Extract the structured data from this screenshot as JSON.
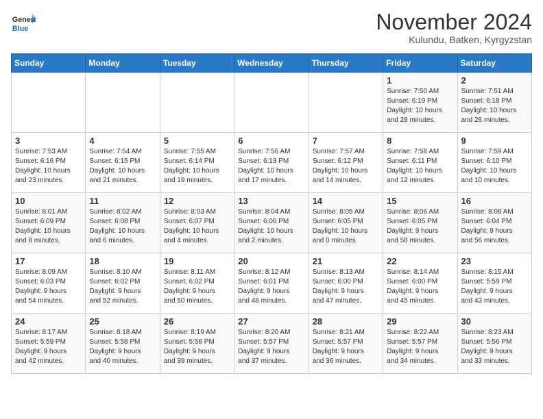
{
  "logo": {
    "line1": "General",
    "line2": "Blue"
  },
  "header": {
    "month": "November 2024",
    "location": "Kulundu, Batken, Kyrgyzstan"
  },
  "weekdays": [
    "Sunday",
    "Monday",
    "Tuesday",
    "Wednesday",
    "Thursday",
    "Friday",
    "Saturday"
  ],
  "weeks": [
    [
      {
        "day": "",
        "info": ""
      },
      {
        "day": "",
        "info": ""
      },
      {
        "day": "",
        "info": ""
      },
      {
        "day": "",
        "info": ""
      },
      {
        "day": "",
        "info": ""
      },
      {
        "day": "1",
        "info": "Sunrise: 7:50 AM\nSunset: 6:19 PM\nDaylight: 10 hours\nand 28 minutes."
      },
      {
        "day": "2",
        "info": "Sunrise: 7:51 AM\nSunset: 6:18 PM\nDaylight: 10 hours\nand 26 minutes."
      }
    ],
    [
      {
        "day": "3",
        "info": "Sunrise: 7:53 AM\nSunset: 6:16 PM\nDaylight: 10 hours\nand 23 minutes."
      },
      {
        "day": "4",
        "info": "Sunrise: 7:54 AM\nSunset: 6:15 PM\nDaylight: 10 hours\nand 21 minutes."
      },
      {
        "day": "5",
        "info": "Sunrise: 7:55 AM\nSunset: 6:14 PM\nDaylight: 10 hours\nand 19 minutes."
      },
      {
        "day": "6",
        "info": "Sunrise: 7:56 AM\nSunset: 6:13 PM\nDaylight: 10 hours\nand 17 minutes."
      },
      {
        "day": "7",
        "info": "Sunrise: 7:57 AM\nSunset: 6:12 PM\nDaylight: 10 hours\nand 14 minutes."
      },
      {
        "day": "8",
        "info": "Sunrise: 7:58 AM\nSunset: 6:11 PM\nDaylight: 10 hours\nand 12 minutes."
      },
      {
        "day": "9",
        "info": "Sunrise: 7:59 AM\nSunset: 6:10 PM\nDaylight: 10 hours\nand 10 minutes."
      }
    ],
    [
      {
        "day": "10",
        "info": "Sunrise: 8:01 AM\nSunset: 6:09 PM\nDaylight: 10 hours\nand 8 minutes."
      },
      {
        "day": "11",
        "info": "Sunrise: 8:02 AM\nSunset: 6:08 PM\nDaylight: 10 hours\nand 6 minutes."
      },
      {
        "day": "12",
        "info": "Sunrise: 8:03 AM\nSunset: 6:07 PM\nDaylight: 10 hours\nand 4 minutes."
      },
      {
        "day": "13",
        "info": "Sunrise: 8:04 AM\nSunset: 6:06 PM\nDaylight: 10 hours\nand 2 minutes."
      },
      {
        "day": "14",
        "info": "Sunrise: 8:05 AM\nSunset: 6:05 PM\nDaylight: 10 hours\nand 0 minutes."
      },
      {
        "day": "15",
        "info": "Sunrise: 8:06 AM\nSunset: 6:05 PM\nDaylight: 9 hours\nand 58 minutes."
      },
      {
        "day": "16",
        "info": "Sunrise: 8:08 AM\nSunset: 6:04 PM\nDaylight: 9 hours\nand 56 minutes."
      }
    ],
    [
      {
        "day": "17",
        "info": "Sunrise: 8:09 AM\nSunset: 6:03 PM\nDaylight: 9 hours\nand 54 minutes."
      },
      {
        "day": "18",
        "info": "Sunrise: 8:10 AM\nSunset: 6:02 PM\nDaylight: 9 hours\nand 52 minutes."
      },
      {
        "day": "19",
        "info": "Sunrise: 8:11 AM\nSunset: 6:02 PM\nDaylight: 9 hours\nand 50 minutes."
      },
      {
        "day": "20",
        "info": "Sunrise: 8:12 AM\nSunset: 6:01 PM\nDaylight: 9 hours\nand 48 minutes."
      },
      {
        "day": "21",
        "info": "Sunrise: 8:13 AM\nSunset: 6:00 PM\nDaylight: 9 hours\nand 47 minutes."
      },
      {
        "day": "22",
        "info": "Sunrise: 8:14 AM\nSunset: 6:00 PM\nDaylight: 9 hours\nand 45 minutes."
      },
      {
        "day": "23",
        "info": "Sunrise: 8:15 AM\nSunset: 5:59 PM\nDaylight: 9 hours\nand 43 minutes."
      }
    ],
    [
      {
        "day": "24",
        "info": "Sunrise: 8:17 AM\nSunset: 5:59 PM\nDaylight: 9 hours\nand 42 minutes."
      },
      {
        "day": "25",
        "info": "Sunrise: 8:18 AM\nSunset: 5:58 PM\nDaylight: 9 hours\nand 40 minutes."
      },
      {
        "day": "26",
        "info": "Sunrise: 8:19 AM\nSunset: 5:58 PM\nDaylight: 9 hours\nand 39 minutes."
      },
      {
        "day": "27",
        "info": "Sunrise: 8:20 AM\nSunset: 5:57 PM\nDaylight: 9 hours\nand 37 minutes."
      },
      {
        "day": "28",
        "info": "Sunrise: 8:21 AM\nSunset: 5:57 PM\nDaylight: 9 hours\nand 36 minutes."
      },
      {
        "day": "29",
        "info": "Sunrise: 8:22 AM\nSunset: 5:57 PM\nDaylight: 9 hours\nand 34 minutes."
      },
      {
        "day": "30",
        "info": "Sunrise: 8:23 AM\nSunset: 5:56 PM\nDaylight: 9 hours\nand 33 minutes."
      }
    ]
  ]
}
